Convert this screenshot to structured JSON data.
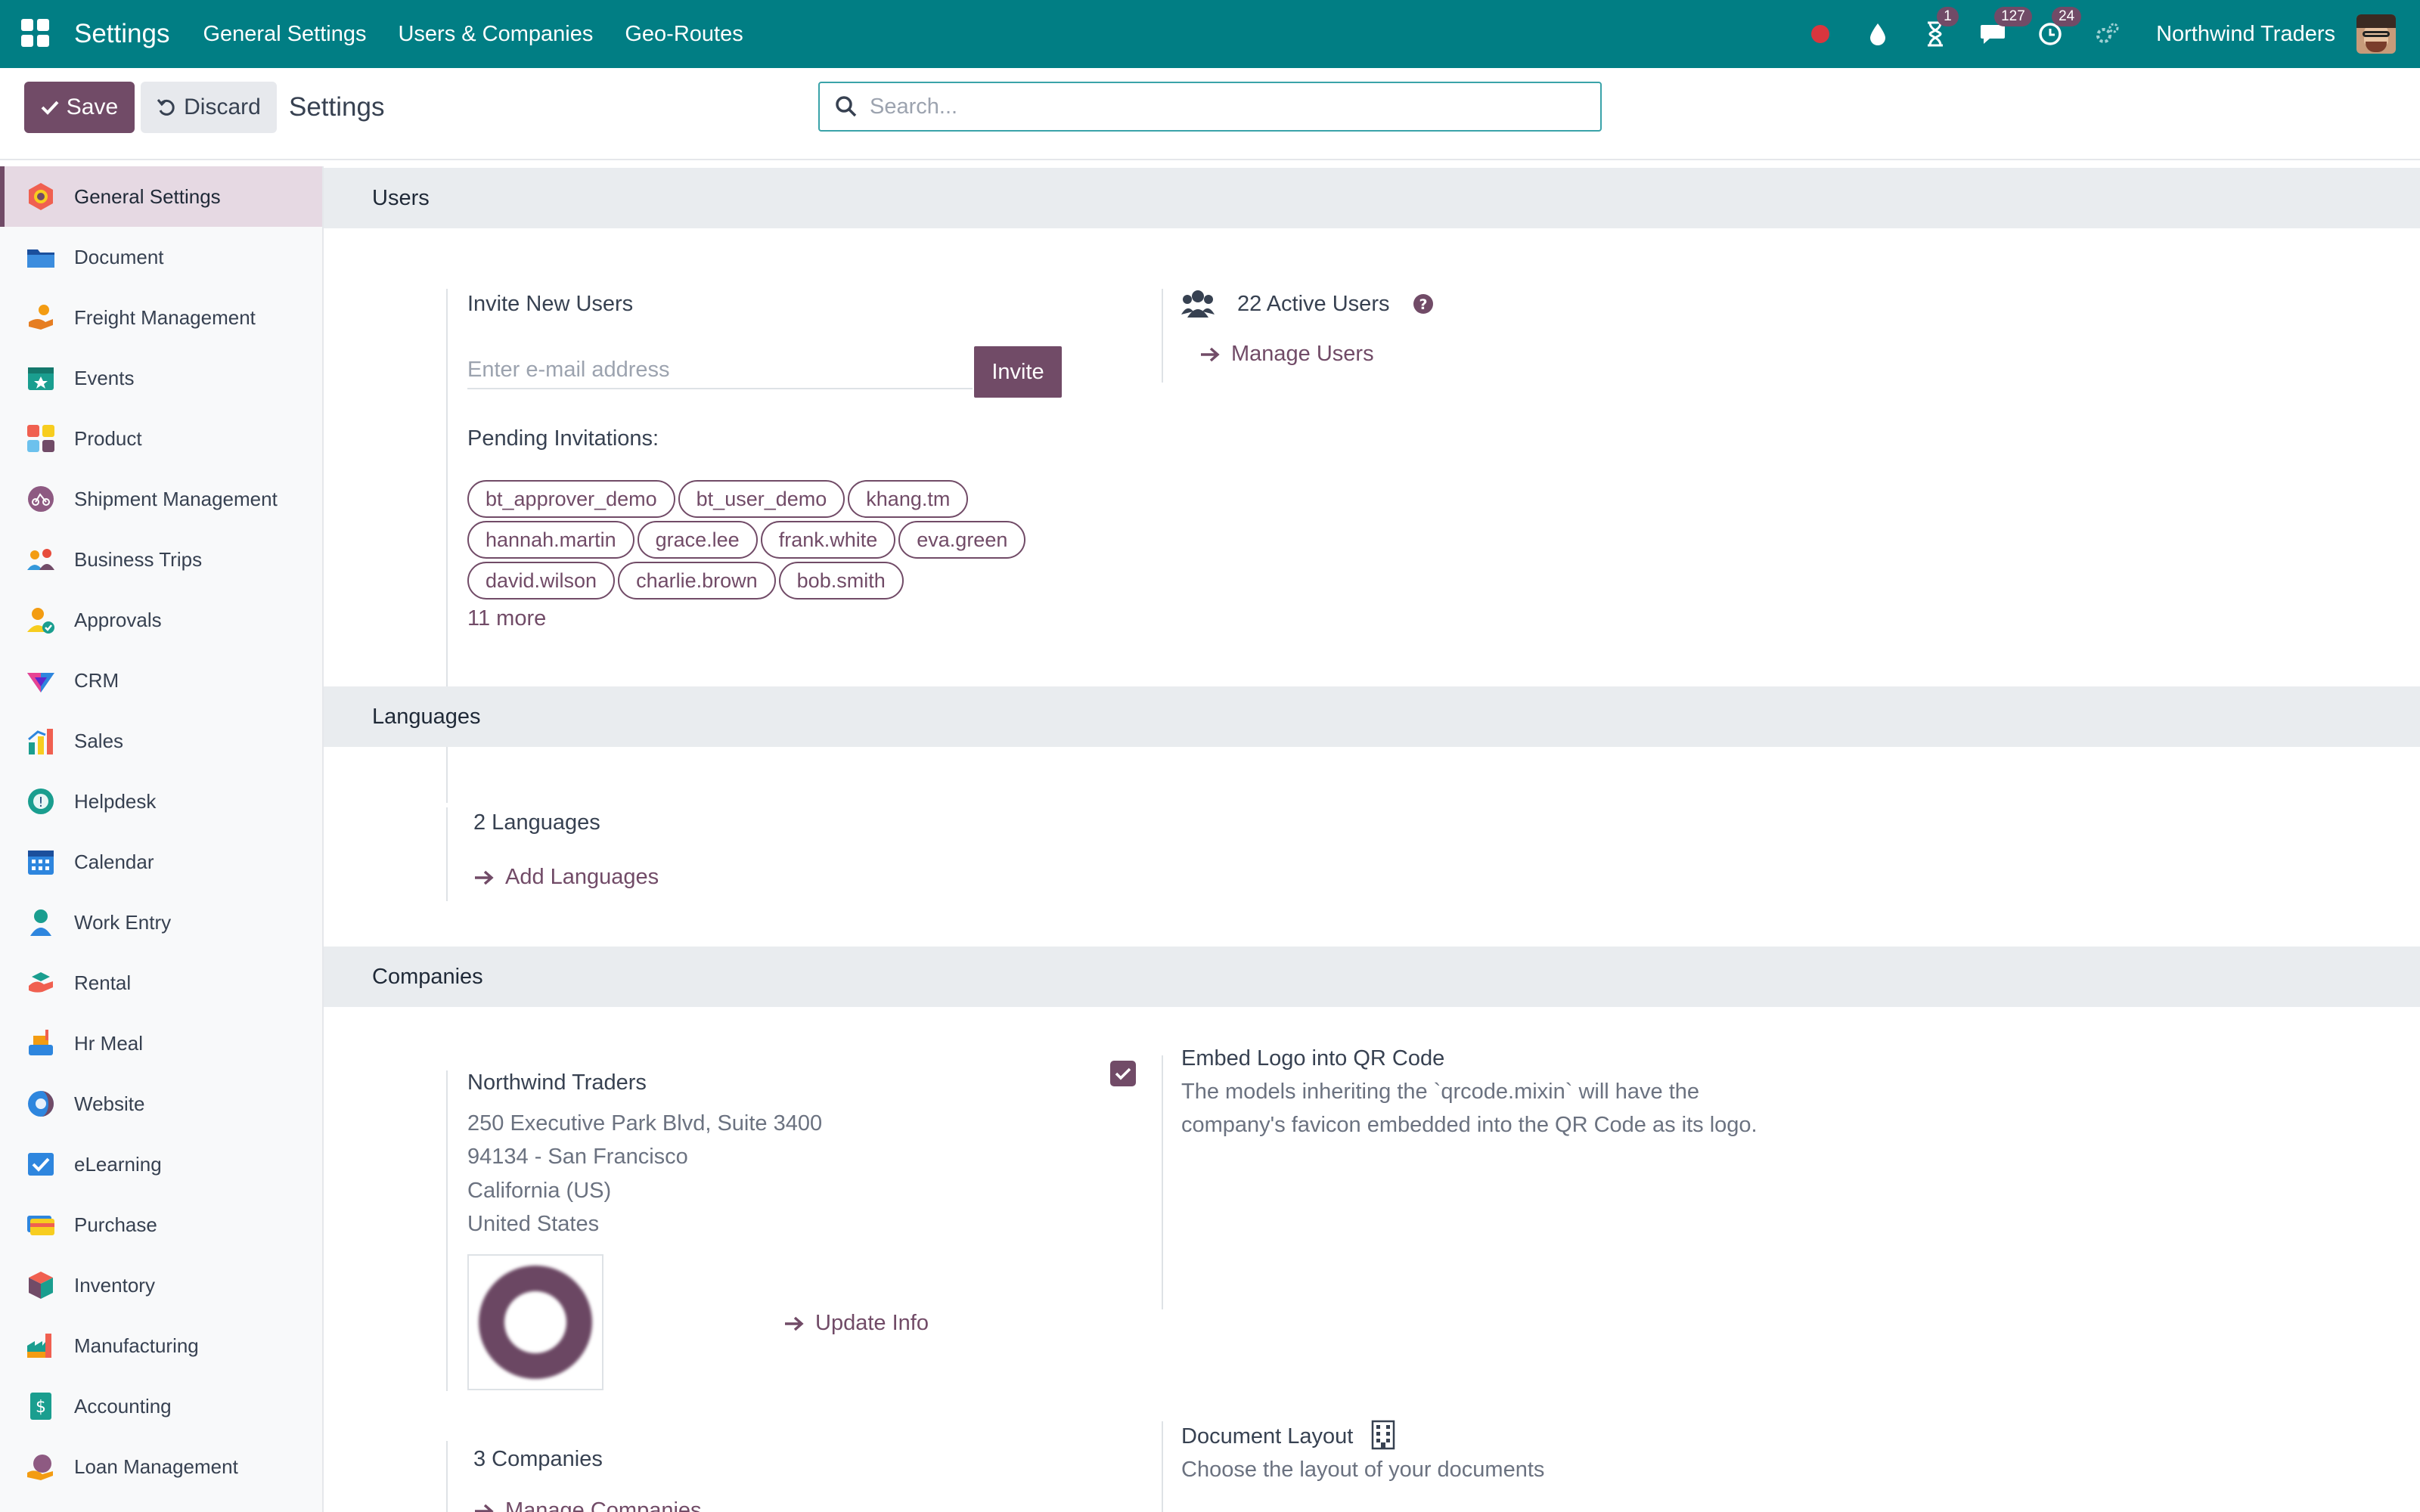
{
  "navbar": {
    "brand": "Settings",
    "menus": [
      "General Settings",
      "Users & Companies",
      "Geo-Routes"
    ],
    "badges": {
      "activities": "1",
      "messages": "127",
      "timesheets": "24"
    },
    "company": "Northwind Traders",
    "bg_color": "#017e84"
  },
  "control_panel": {
    "save_label": "Save",
    "discard_label": "Discard",
    "title": "Settings",
    "search_placeholder": "Search..."
  },
  "sidebar": {
    "items": [
      {
        "label": "General Settings",
        "icon": "general-settings-icon"
      },
      {
        "label": "Document",
        "icon": "folder-icon"
      },
      {
        "label": "Freight Management",
        "icon": "freight-icon"
      },
      {
        "label": "Events",
        "icon": "events-icon"
      },
      {
        "label": "Product",
        "icon": "product-icon"
      },
      {
        "label": "Shipment Management",
        "icon": "shipment-icon"
      },
      {
        "label": "Business Trips",
        "icon": "business-trips-icon"
      },
      {
        "label": "Approvals",
        "icon": "approvals-icon"
      },
      {
        "label": "CRM",
        "icon": "crm-icon"
      },
      {
        "label": "Sales",
        "icon": "sales-icon"
      },
      {
        "label": "Helpdesk",
        "icon": "helpdesk-icon"
      },
      {
        "label": "Calendar",
        "icon": "calendar-icon"
      },
      {
        "label": "Work Entry",
        "icon": "work-entry-icon"
      },
      {
        "label": "Rental",
        "icon": "rental-icon"
      },
      {
        "label": "Hr Meal",
        "icon": "hr-meal-icon"
      },
      {
        "label": "Website",
        "icon": "website-icon"
      },
      {
        "label": "eLearning",
        "icon": "elearning-icon"
      },
      {
        "label": "Purchase",
        "icon": "purchase-icon"
      },
      {
        "label": "Inventory",
        "icon": "inventory-icon"
      },
      {
        "label": "Manufacturing",
        "icon": "manufacturing-icon"
      },
      {
        "label": "Accounting",
        "icon": "accounting-icon"
      },
      {
        "label": "Loan Management",
        "icon": "loan-icon"
      }
    ],
    "active_index": 0
  },
  "users": {
    "section_title": "Users",
    "invite_title": "Invite New Users",
    "email_placeholder": "Enter e-mail address",
    "invite_label": "Invite",
    "pending_title": "Pending Invitations:",
    "pending": [
      "bt_approver_demo",
      "bt_user_demo",
      "khang.tm",
      "hannah.martin",
      "grace.lee",
      "frank.white",
      "eva.green",
      "david.wilson",
      "charlie.brown",
      "bob.smith"
    ],
    "more_label": "11 more",
    "active_users": "22 Active Users",
    "manage_users": "Manage Users"
  },
  "languages": {
    "section_title": "Languages",
    "count": "2 Languages",
    "add_label": "Add Languages"
  },
  "companies": {
    "section_title": "Companies",
    "name": "Northwind Traders",
    "address": [
      "250 Executive Park Blvd, Suite 3400",
      "94134 - San Francisco",
      "California (US)",
      "United States"
    ],
    "update_info": "Update Info",
    "count": "3 Companies",
    "manage_label": "Manage Companies",
    "embed_logo_title": "Embed Logo into QR Code",
    "embed_logo_desc_1": "The models inheriting the `qrcode.mixin` will have the",
    "embed_logo_desc_2": "company's favicon embedded into the QR Code as its logo.",
    "embed_logo_checked": true,
    "doc_layout_title": "Document Layout",
    "doc_layout_desc": "Choose the layout of your documents"
  },
  "colors": {
    "accent": "#714b67",
    "teal": "#017e84"
  }
}
